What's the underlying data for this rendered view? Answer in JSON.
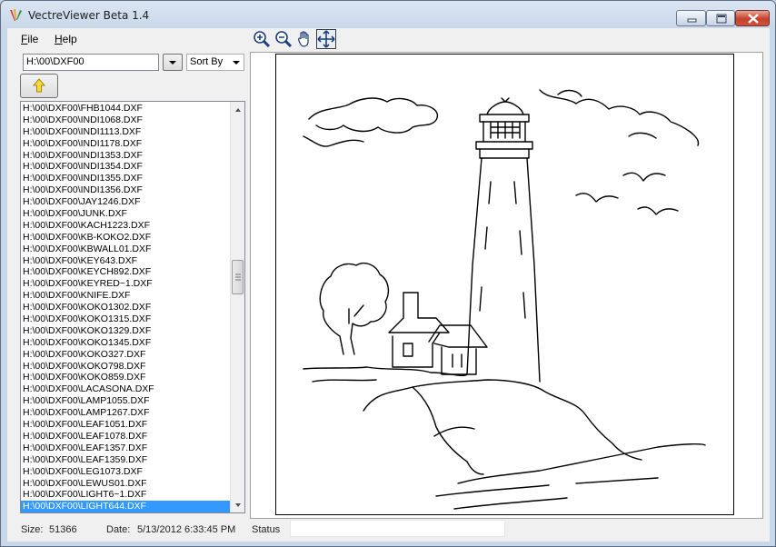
{
  "window": {
    "title": "VectreViewer Beta 1.4"
  },
  "menu": {
    "file_label": "File",
    "file_accel": "F",
    "file_rest": "ile",
    "help_accel": "H",
    "help_rest": "elp"
  },
  "toolbar": {
    "icons": [
      "zoom-in-icon",
      "zoom-out-icon",
      "pan-hand-icon",
      "fit-view-icon"
    ]
  },
  "browser": {
    "path_value": "H:\\00\\DXF00",
    "sort_label": "Sort By"
  },
  "files": [
    "H:\\00\\DXF00\\FHB1044.DXF",
    "H:\\00\\DXF00\\INDI1068.DXF",
    "H:\\00\\DXF00\\INDI1113.DXF",
    "H:\\00\\DXF00\\INDI1178.DXF",
    "H:\\00\\DXF00\\INDI1353.DXF",
    "H:\\00\\DXF00\\INDI1354.DXF",
    "H:\\00\\DXF00\\INDI1355.DXF",
    "H:\\00\\DXF00\\INDI1356.DXF",
    "H:\\00\\DXF00\\JAY1246.DXF",
    "H:\\00\\DXF00\\JUNK.DXF",
    "H:\\00\\DXF00\\KACH1223.DXF",
    "H:\\00\\DXF00\\KB-KOKO2.DXF",
    "H:\\00\\DXF00\\KBWALL01.DXF",
    "H:\\00\\DXF00\\KEY643.DXF",
    "H:\\00\\DXF00\\KEYCH892.DXF",
    "H:\\00\\DXF00\\KEYRED~1.DXF",
    "H:\\00\\DXF00\\KNIFE.DXF",
    "H:\\00\\DXF00\\KOKO1302.DXF",
    "H:\\00\\DXF00\\KOKO1315.DXF",
    "H:\\00\\DXF00\\KOKO1329.DXF",
    "H:\\00\\DXF00\\KOKO1345.DXF",
    "H:\\00\\DXF00\\KOKO327.DXF",
    "H:\\00\\DXF00\\KOKO798.DXF",
    "H:\\00\\DXF00\\KOKO859.DXF",
    "H:\\00\\DXF00\\LACASONA.DXF",
    "H:\\00\\DXF00\\LAMP1055.DXF",
    "H:\\00\\DXF00\\LAMP1267.DXF",
    "H:\\00\\DXF00\\LEAF1051.DXF",
    "H:\\00\\DXF00\\LEAF1078.DXF",
    "H:\\00\\DXF00\\LEAF1357.DXF",
    "H:\\00\\DXF00\\LEAF1359.DXF",
    "H:\\00\\DXF00\\LEG1073.DXF",
    "H:\\00\\DXF00\\LEWUS01.DXF",
    "H:\\00\\DXF00\\LIGHT6~1.DXF",
    "H:\\00\\DXF00\\LIGHT644.DXF"
  ],
  "selected_index": 34,
  "status": {
    "size_label": "Size:",
    "size_value": "51366",
    "date_label": "Date:",
    "date_value": "5/13/2012 6:33:45 PM",
    "status_label": "Status",
    "status_value": ""
  },
  "colors": {
    "selection": "#3399ff",
    "close_button": "#c4402a"
  }
}
